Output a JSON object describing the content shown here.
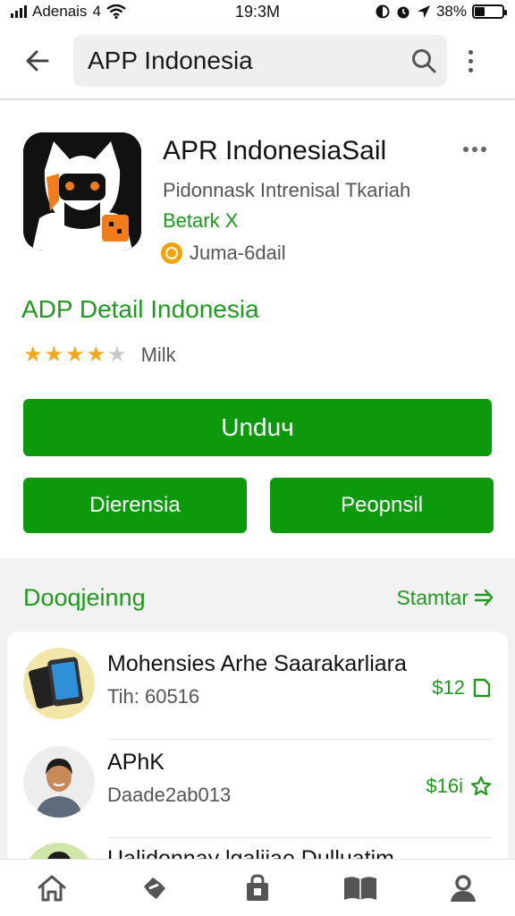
{
  "status_bar": {
    "carrier": "Adenais",
    "network": "4",
    "time": "19:3M",
    "battery": "38%",
    "battery_level": 0.38
  },
  "app_bar": {
    "search_value": "APP Indonesia"
  },
  "app_detail": {
    "title": "APR IndonesiaSail",
    "developer": "Pidonnask Intrenisal Tkariah",
    "badge": "Betark X",
    "meta": "Juma-6dail",
    "detail_heading": "ADP Detail Indonesia",
    "rating": 4,
    "rating_label": "Milk",
    "primary_button": "Unduч",
    "secondary_left": "Dierensia",
    "secondary_right": "Peopnsil"
  },
  "section": {
    "title": "Dooqjeinng",
    "link": "Stamtar"
  },
  "list": [
    {
      "title": "Mohensies Arhe Saarakarliara",
      "subtitle": "Tih: 60516",
      "price": "$12",
      "icon": "copy-icon"
    },
    {
      "title": "APhK",
      "subtitle": "Daade2ab013",
      "price": "$16i",
      "icon": "star-outline-icon"
    },
    {
      "title": "Ualidonnay lgaliiae Dulluatim",
      "subtitle": "",
      "price": "",
      "icon": ""
    }
  ],
  "bottom_nav": [
    {
      "icon": "home-icon"
    },
    {
      "icon": "games-icon"
    },
    {
      "icon": "shopping-bag-icon"
    },
    {
      "icon": "book-icon"
    },
    {
      "icon": "account-icon"
    }
  ],
  "colors": {
    "accent_green": "#0c9a0c",
    "text_green": "#1f9a1f",
    "star": "#f2a81d"
  }
}
